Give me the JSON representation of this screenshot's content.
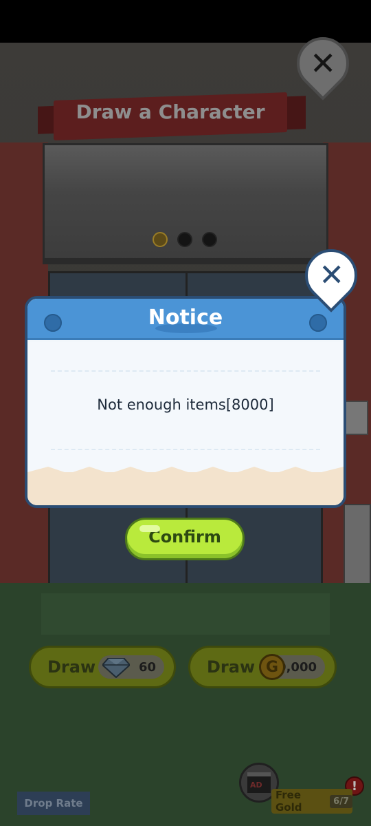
{
  "screen": {
    "title": "Draw a Character",
    "pager_total": 3,
    "pager_active_index": 0
  },
  "draw_buttons": [
    {
      "label": "Draw",
      "currency_icon": "gem-icon",
      "cost": "60"
    },
    {
      "label": "Draw",
      "currency_icon": "gold-coin-icon",
      "cost": "30,000"
    }
  ],
  "footer": {
    "drop_rate_label": "Drop Rate",
    "free_gold_label": "Free Gold",
    "free_gold_count": "6/7",
    "ad_icon_text": "AD",
    "alert_badge": "!"
  },
  "dialog": {
    "title": "Notice",
    "message": "Not enough items[8000]",
    "confirm_label": "Confirm"
  },
  "colors": {
    "dialog_header": "#4b94d6",
    "dialog_border": "#2b4d74",
    "confirm_button": "#b9ea3c",
    "dialog_footer": "#f3e3cd"
  }
}
